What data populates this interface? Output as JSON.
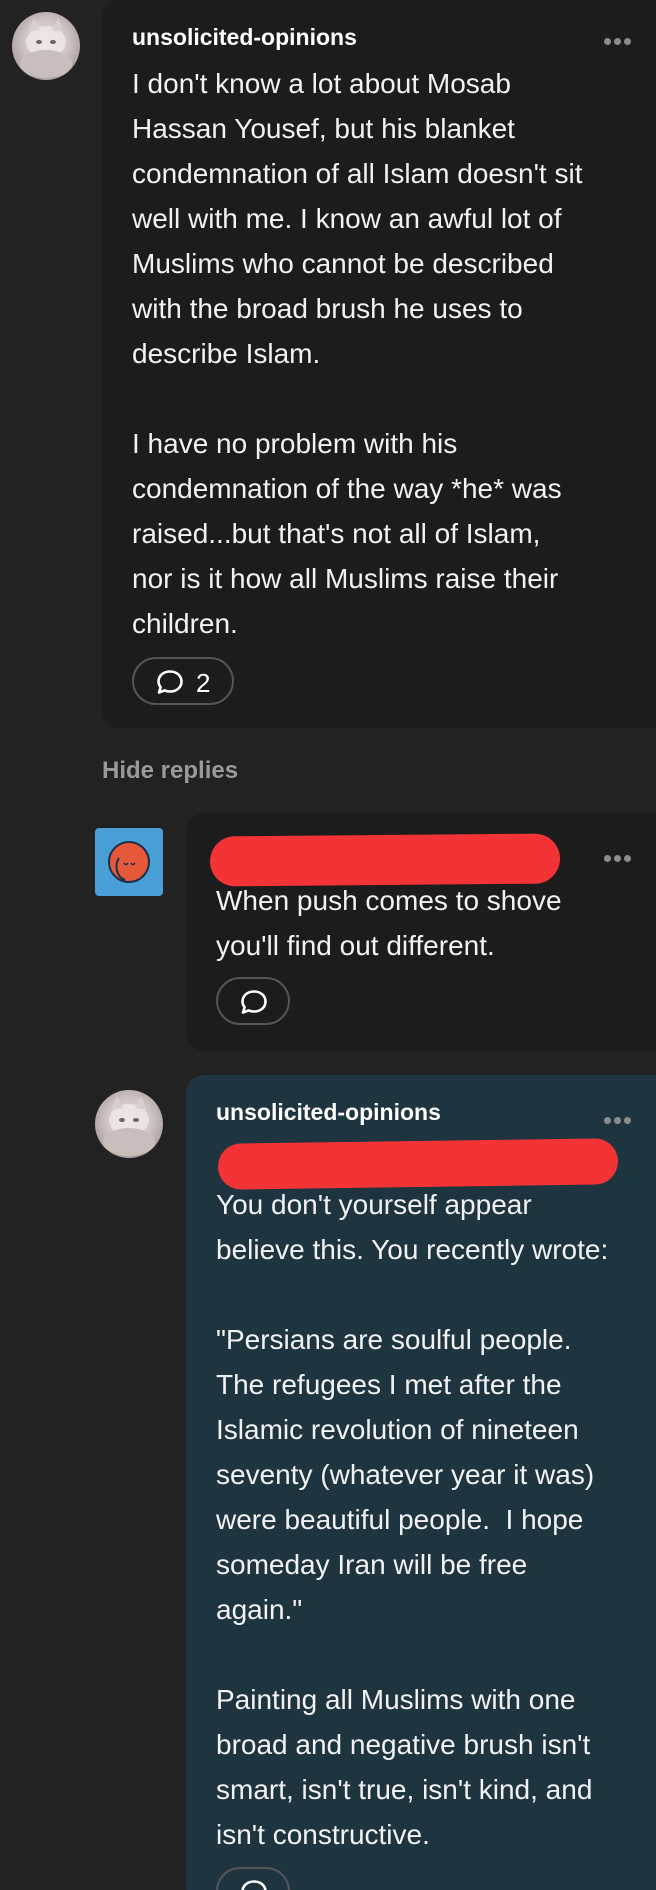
{
  "comments": [
    {
      "username": "unsolicited-opinions",
      "text": "I don't know a lot about Mosab\nHassan Yousef, but his blanket\ncondemnation of all Islam doesn't sit\nwell with me. I know an awful lot of\nMuslims who cannot be described\nwith the broad brush he uses to\ndescribe Islam.\n\nI have no problem with his\ncondemnation of the way *he* was\nraised...but that's not all of Islam,\nnor is it how all Muslims raise their\nchildren.",
      "reply_count": "2",
      "icon": "speech-bubble-icon"
    }
  ],
  "hide_replies_label": "Hide replies",
  "replies": [
    {
      "username": "",
      "username_redacted": true,
      "text": "When push comes to shove\nyou'll find out different.",
      "icon": "speech-bubble-icon"
    },
    {
      "username": "unsolicited-opinions",
      "mention_redacted": true,
      "text": "You don't yourself appear\nbelieve this. You recently wrote:\n\n\"Persians are soulful people.\nThe refugees I met after the\nIslamic revolution of nineteen\nseventy (whatever year it was)\nwere beautiful people.  I hope\nsomeday Iran will be free\nagain.\"\n\nPainting all Muslims with one\nbroad and negative brush isn't\nsmart, isn't true, isn't kind, and\nisn't constructive."
    }
  ],
  "colors": {
    "background": "#222222",
    "comment_card": "#1c1c1c",
    "highlighted_reply_card": "#1e3540",
    "redaction": "#f43336",
    "avatar_blue": "#4a9fd6",
    "avatar_orange": "#e5583a"
  }
}
